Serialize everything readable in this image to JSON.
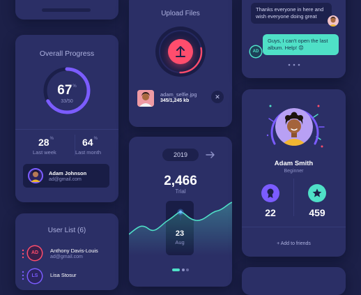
{
  "progress_card": {
    "title": "Overall Progress",
    "percent": "67",
    "percent_symbol": "%",
    "fraction": "33/50",
    "progress_value": 0.67,
    "last_week_value": "28",
    "last_week_label": "Last week",
    "last_month_value": "64",
    "last_month_label": "Last month",
    "user_name": "Adam Johnson",
    "user_email": "ad@gmail.com"
  },
  "user_list": {
    "title": "User List (6)",
    "users": [
      {
        "initials": "AD",
        "name": "Anthony Davis-Louis",
        "email": "ad@gmail.com"
      },
      {
        "initials": "LS",
        "name": "Lisa Stosur",
        "email": ""
      }
    ]
  },
  "upload_card": {
    "title": "Upload Files",
    "file_name": "adam_selfie.jpg",
    "file_size": "345/1,245 kb",
    "upload_progress": 0.28
  },
  "trial_card": {
    "year": "2019",
    "value": "2,466",
    "label": "Trial",
    "hover_day": "23",
    "hover_month": "Aug"
  },
  "chat": {
    "message_in": "Thanks everyone in here and wish everyone doing great",
    "message_out": "Guys, I can't open the last album. Help! 😟",
    "sender_initials": "AD"
  },
  "profile": {
    "name": "Adam Smith",
    "role": "Beginner",
    "awards_count": "22",
    "stars_count": "459",
    "add_friends": "+ Add to friends"
  },
  "colors": {
    "background": "#1c2048",
    "card": "#2b2f66",
    "accent_purple": "#7b5cff",
    "accent_red": "#ff4d6d",
    "accent_teal": "#4fe0c7"
  },
  "icons": [
    "upload-arrow-icon",
    "close-icon",
    "arrow-right-icon",
    "award-icon",
    "star-icon",
    "more-dots-icon"
  ]
}
